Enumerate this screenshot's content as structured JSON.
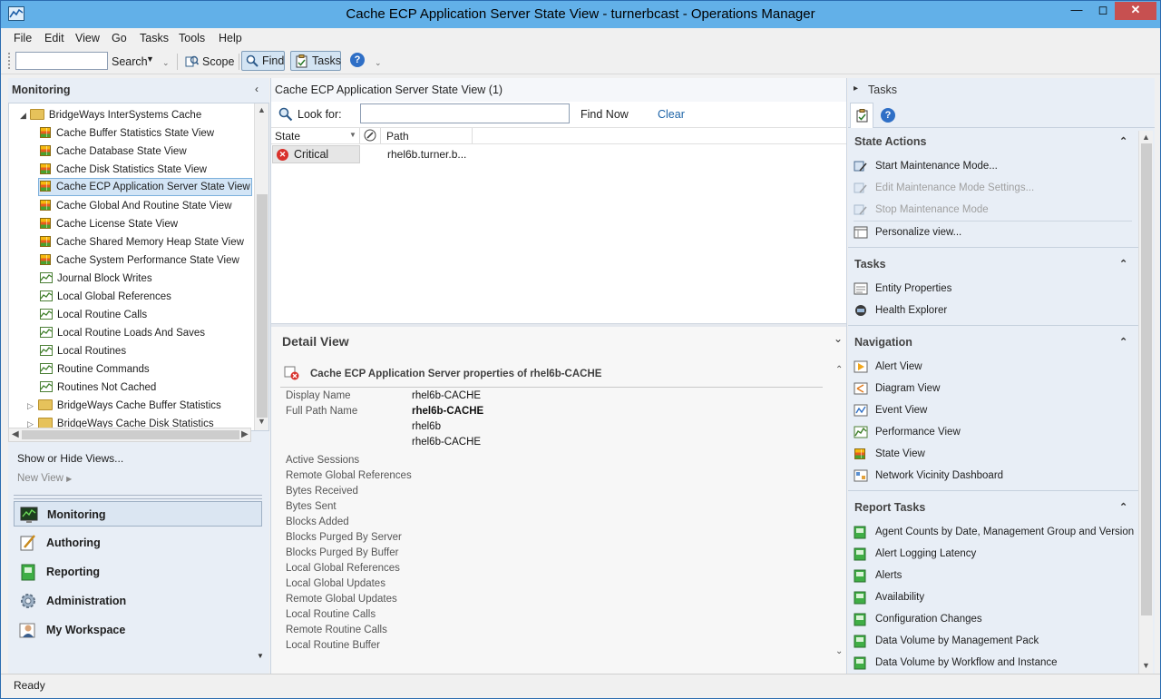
{
  "window": {
    "title": "Cache ECP Application Server State View - turnerbcast - Operations Manager"
  },
  "menu": [
    "File",
    "Edit",
    "View",
    "Go",
    "Tasks",
    "Tools",
    "Help"
  ],
  "toolbar": {
    "search_label": "Search",
    "scope_label": "Scope",
    "find_label": "Find",
    "tasks_label": "Tasks"
  },
  "left": {
    "header": "Monitoring",
    "root_folder": "BridgeWays InterSystems Cache",
    "views": [
      "Cache Buffer Statistics State View",
      "Cache Database State View",
      "Cache Disk Statistics State View",
      "Cache ECP Application Server State View",
      "Cache Global And Routine State View",
      "Cache License State View",
      "Cache Shared Memory Heap State View",
      "Cache System Performance State View",
      "Journal Block Writes",
      "Local Global References",
      "Local Routine Calls",
      "Local Routine Loads And Saves",
      "Local Routines",
      "Routine Commands",
      "Routines Not Cached"
    ],
    "subfolders": [
      "BridgeWays Cache Buffer Statistics",
      "BridgeWays Cache Disk Statistics"
    ],
    "show_hide": "Show or Hide Views...",
    "new_view": "New View",
    "wunderbar": [
      "Monitoring",
      "Authoring",
      "Reporting",
      "Administration",
      "My Workspace"
    ]
  },
  "center": {
    "title": "Cache ECP Application Server State View (1)",
    "look_for": "Look for:",
    "find_now": "Find Now",
    "clear": "Clear",
    "columns": {
      "state": "State",
      "path": "Path"
    },
    "row": {
      "state": "Critical",
      "path": "rhel6b.turner.b..."
    },
    "detail_title": "Detail View",
    "detail_subtitle": "Cache ECP Application Server properties of rhel6b-CACHE",
    "display_name_label": "Display Name",
    "display_name_value": "rhel6b-CACHE",
    "full_path_label": "Full Path Name",
    "full_path_values": [
      "rhel6b-CACHE",
      "rhel6b",
      "rhel6b-CACHE"
    ],
    "properties": [
      "Active Sessions",
      "Remote Global References",
      "Bytes Received",
      "Bytes Sent",
      "Blocks Added",
      "Blocks Purged By Server",
      "Blocks Purged By Buffer",
      "Local Global References",
      "Local Global Updates",
      "Remote Global Updates",
      "Local Routine Calls",
      "Remote Routine Calls",
      "Local Routine Buffer"
    ]
  },
  "right": {
    "header": "Tasks",
    "state_actions_title": "State Actions",
    "state_actions": [
      "Start Maintenance Mode...",
      "Edit Maintenance Mode Settings...",
      "Stop Maintenance Mode",
      "Personalize view..."
    ],
    "tasks_title": "Tasks",
    "tasks": [
      "Entity Properties",
      "Health Explorer"
    ],
    "navigation_title": "Navigation",
    "navigation": [
      "Alert View",
      "Diagram View",
      "Event View",
      "Performance View",
      "State View",
      "Network Vicinity Dashboard"
    ],
    "report_title": "Report Tasks",
    "reports": [
      "Agent Counts by Date, Management Group and Version",
      "Alert Logging Latency",
      "Alerts",
      "Availability",
      "Configuration Changes",
      "Data Volume by Management Pack",
      "Data Volume by Workflow and Instance"
    ]
  },
  "status": {
    "text": "Ready"
  },
  "colors": {
    "titlebar": "#62b0e8",
    "critical": "#d9312b",
    "selection": "#d3e5f6"
  }
}
